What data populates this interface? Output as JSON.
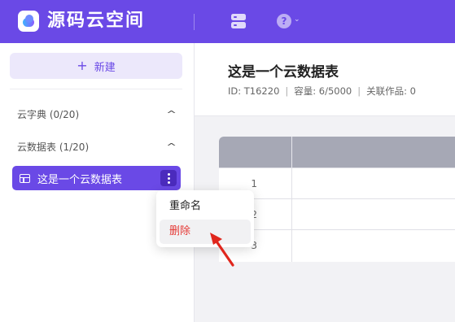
{
  "app": {
    "title": "源码云空间"
  },
  "topbar": {
    "db_icon": "database-icon",
    "help_icon": "help-circle-icon",
    "help_glyph": "?",
    "help_chevron": "⌄"
  },
  "sidebar": {
    "new_button": {
      "icon": "plus-icon",
      "label": "新建"
    },
    "sections": [
      {
        "label": "云字典 (0/20)",
        "chevron": "^"
      },
      {
        "label": "云数据表 (1/20)",
        "chevron": "^"
      }
    ],
    "active_item": {
      "label": "这是一个云数据表",
      "icon": "table-icon"
    }
  },
  "main": {
    "title": "这是一个云数据表",
    "meta": {
      "id": "ID: T16220",
      "capacity": "容量: 6/5000",
      "linked": "关联作品: 0",
      "separator": "|"
    },
    "grid": {
      "row_numbers": [
        "1",
        "2",
        "3"
      ]
    }
  },
  "context_menu": {
    "items": [
      "重命名",
      "删除"
    ],
    "highlighted": "删除"
  },
  "colors": {
    "brand": "#6a49e6",
    "brand_dark": "#4b2bbd",
    "danger": "#e53935",
    "header": "#a6a8b5",
    "cursor": "#e0261c"
  }
}
